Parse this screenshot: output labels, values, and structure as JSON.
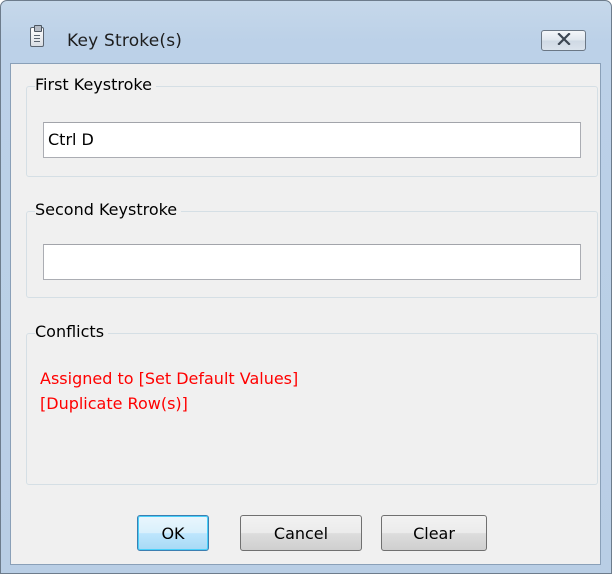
{
  "window": {
    "title": "Key Stroke(s)",
    "icon": "clipboard-icon",
    "close_glyph": "⌧"
  },
  "first_keystroke": {
    "label": "First Keystroke",
    "value": "Ctrl D"
  },
  "second_keystroke": {
    "label": "Second Keystroke",
    "value": ""
  },
  "conflicts": {
    "label": "Conflicts",
    "lines": [
      "Assigned to [Set Default Values]",
      "[Duplicate Row(s)]"
    ],
    "color": "#ff0000"
  },
  "buttons": {
    "ok": "OK",
    "cancel": "Cancel",
    "clear": "Clear"
  },
  "colors": {
    "frame": "#bcd1e8",
    "client": "#f0f0f0",
    "default_button": "#bee6fd"
  }
}
